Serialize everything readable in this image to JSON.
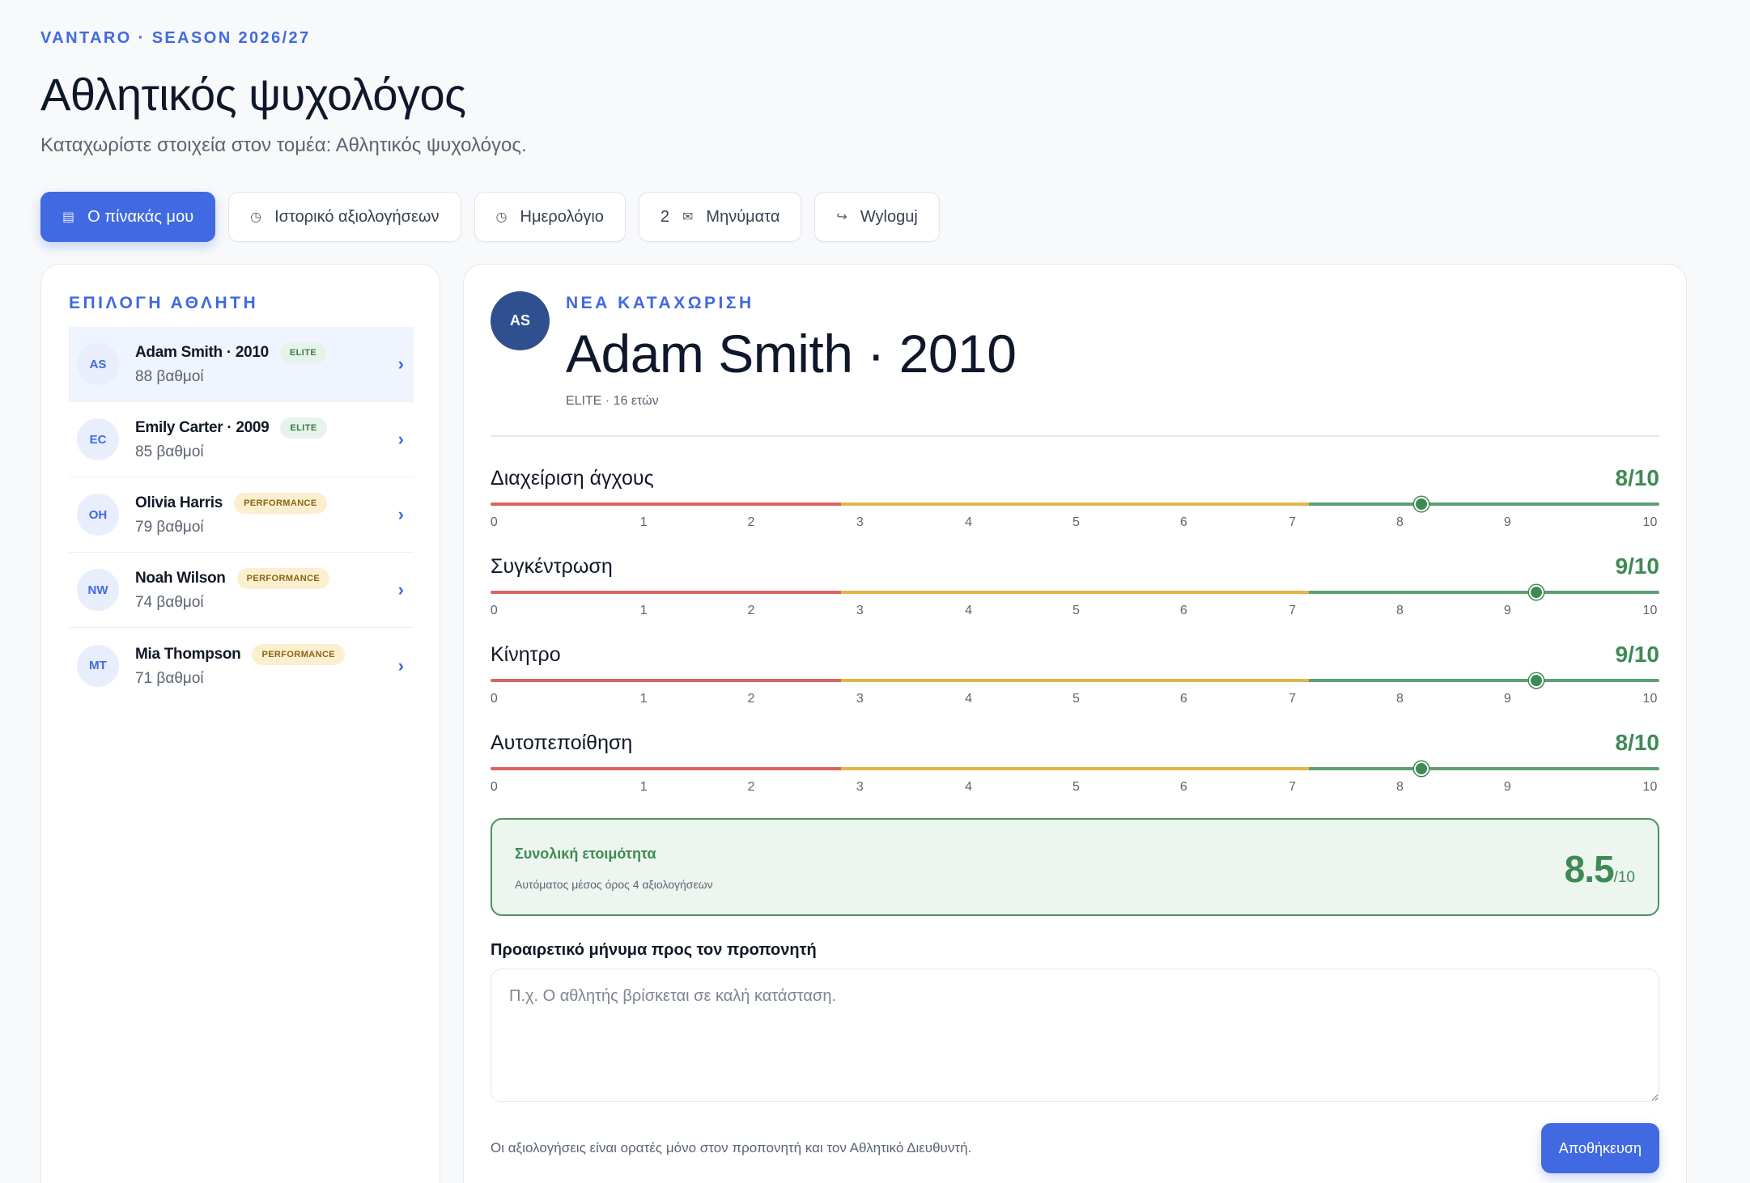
{
  "header": {
    "eyebrow": "VANTARO · SEASON 2026/27",
    "title": "Αθλητικός ψυχολόγος",
    "subtitle": "Καταχωρίστε στοιχεία στον τομέα: Αθλητικός ψυχολόγος."
  },
  "nav": {
    "dashboard": {
      "label": "Ο πίνακάς μου",
      "icon": "dashboard-icon"
    },
    "history": {
      "label": "Ιστορικό αξιολογήσεων",
      "icon": "clock-icon"
    },
    "calendar": {
      "label": "Ημερολόγιο",
      "icon": "clock-icon"
    },
    "messages": {
      "label": "Μηνύματα",
      "count": "2",
      "icon": "mail-icon"
    },
    "logout": {
      "label": "Wyloguj",
      "icon": "logout-arrow-icon"
    }
  },
  "athletes": {
    "heading": "ΕΠΙΛΟΓΗ ΑΘΛΗΤΗ",
    "items": [
      {
        "initials": "AS",
        "name": "Adam Smith · 2010",
        "badge": "ELITE",
        "points": "88 βαθμοί"
      },
      {
        "initials": "EC",
        "name": "Emily Carter · 2009",
        "badge": "ELITE",
        "points": "85 βαθμοί"
      },
      {
        "initials": "OH",
        "name": "Olivia Harris",
        "badge": "PERFORMANCE",
        "points": "79 βαθμοί"
      },
      {
        "initials": "NW",
        "name": "Noah Wilson",
        "badge": "PERFORMANCE",
        "points": "74 βαθμοί"
      },
      {
        "initials": "MT",
        "name": "Mia Thompson",
        "badge": "PERFORMANCE",
        "points": "71 βαθμοί"
      }
    ]
  },
  "entry": {
    "heading": "ΝΕΑ ΚΑΤΑΧΩΡΙΣΗ",
    "avatar": "AS",
    "name": "Adam Smith · 2010",
    "meta": "ELITE · 16 ετών"
  },
  "scale_ticks": [
    "0",
    "1",
    "2",
    "3",
    "4",
    "5",
    "6",
    "7",
    "8",
    "9",
    "10"
  ],
  "metrics": [
    {
      "label": "Διαχείριση άγχους",
      "score": "8/10",
      "value": 8
    },
    {
      "label": "Συγκέντρωση",
      "score": "9/10",
      "value": 9
    },
    {
      "label": "Κίνητρο",
      "score": "9/10",
      "value": 9
    },
    {
      "label": "Αυτοπεποίθηση",
      "score": "8/10",
      "value": 8
    }
  ],
  "readiness": {
    "title": "Συνολική ετοιμότητα",
    "subtitle": "Αυτόματος μέσος όρος 4 αξιολογήσεων",
    "value": "8.5",
    "denominator": "/10"
  },
  "message": {
    "label": "Προαιρετικό μήνυμα προς τον προπονητή",
    "placeholder": "Π.χ. Ο αθλητής βρίσκεται σε καλή κατάσταση.",
    "value": ""
  },
  "footer": {
    "note": "Οι αξιολογήσεις είναι ορατές μόνο στον προπονητή και τον Αθλητικό Διευθυντή.",
    "save_label": "Αποθήκευση"
  },
  "colors": {
    "accent": "#4169e1",
    "success": "#3e8a55",
    "scale_low": "#d9655f",
    "scale_mid": "#e0b64a",
    "scale_high": "#5ea072"
  }
}
